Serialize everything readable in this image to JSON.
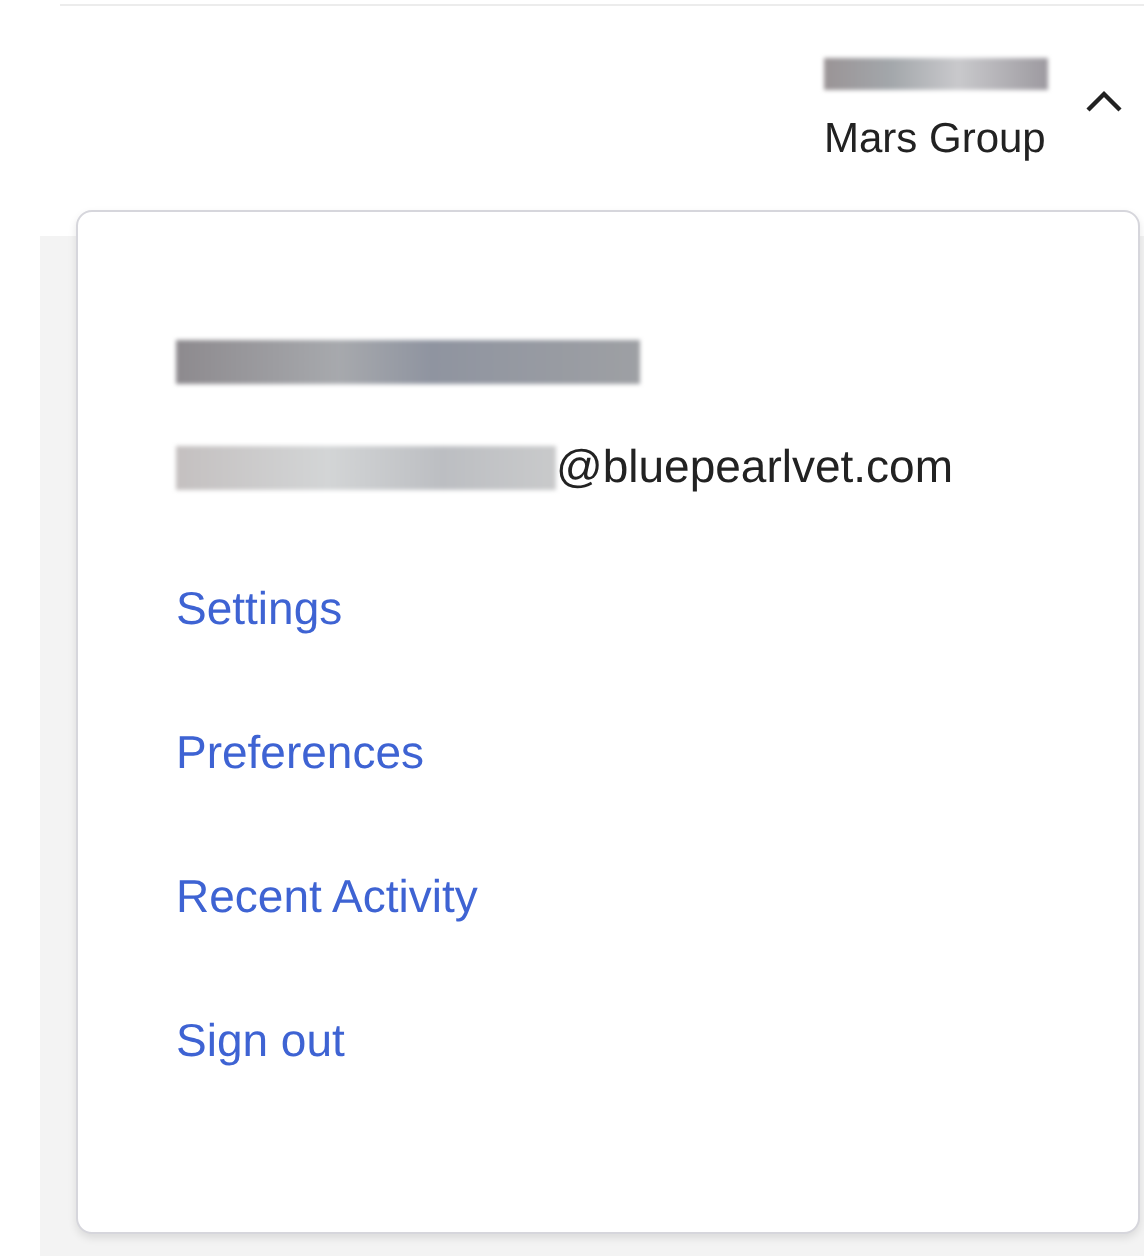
{
  "account_button": {
    "organization": "Mars Group",
    "expanded": true
  },
  "menu": {
    "email_domain": "@bluepearlvet.com",
    "links": [
      {
        "label": "Settings"
      },
      {
        "label": "Preferences"
      },
      {
        "label": "Recent Activity"
      },
      {
        "label": "Sign out"
      }
    ]
  }
}
